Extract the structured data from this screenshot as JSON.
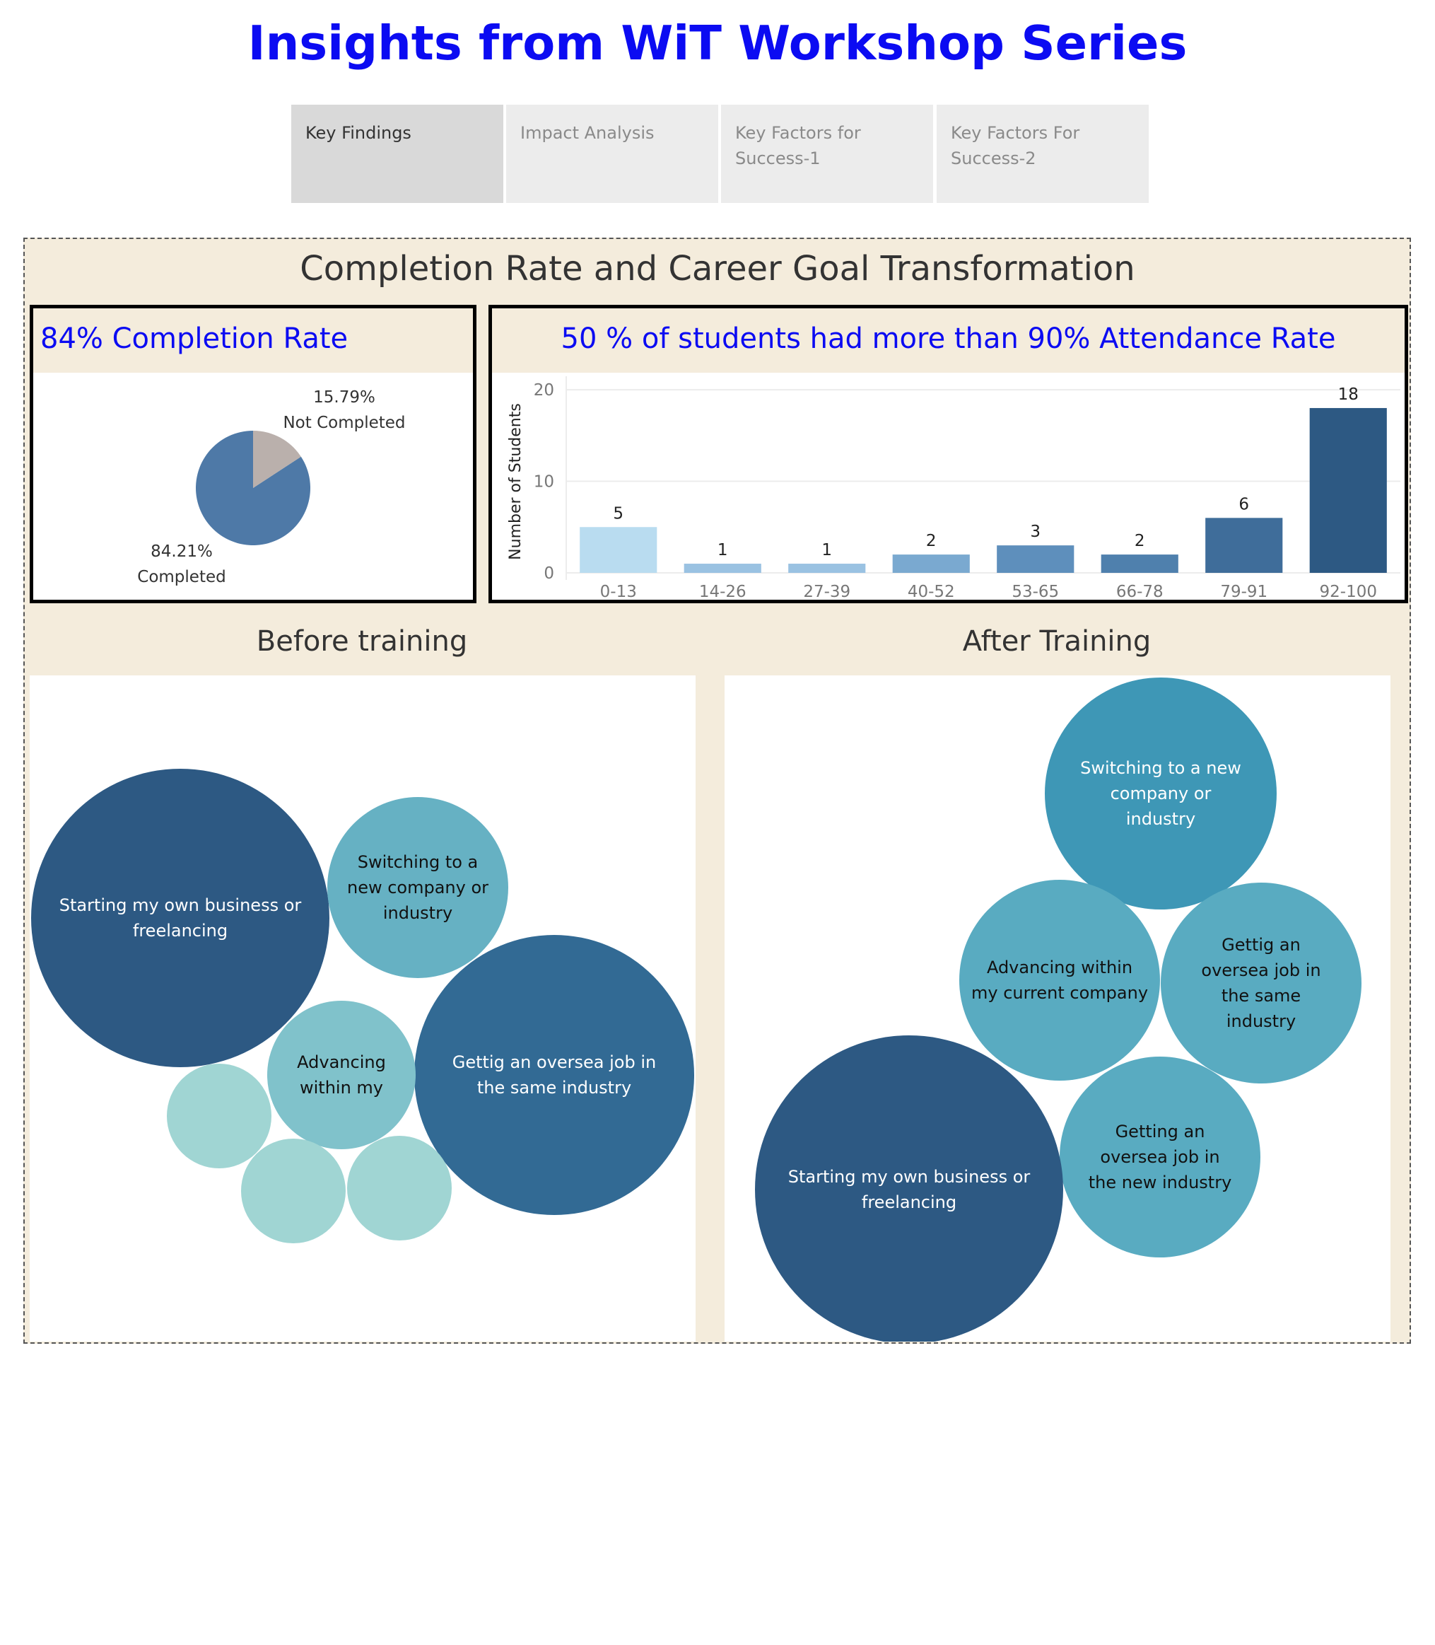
{
  "title": "Insights from WiT Workshop Series",
  "tabs": [
    {
      "label": "Key Findings",
      "active": true
    },
    {
      "label": "Impact Analysis",
      "active": false
    },
    {
      "label": "Key Factors for Success-1",
      "active": false
    },
    {
      "label": "Key Factors For Success-2",
      "active": false
    }
  ],
  "dashboard_title": "Completion Rate and Career Goal Transformation",
  "colors": {
    "title_blue": "#0b0bf2",
    "background": "#f4ecdc",
    "pie_completed": "#4e79a7",
    "pie_not_completed": "#bab0ac"
  },
  "chart_data": [
    {
      "type": "pie",
      "title": "84% Completion Rate",
      "slices": [
        {
          "label": "Completed",
          "value": 84.21,
          "display": "84.21%",
          "color": "#4e79a7"
        },
        {
          "label": "Not Completed",
          "value": 15.79,
          "display": "15.79%",
          "color": "#bab0ac"
        }
      ]
    },
    {
      "type": "bar",
      "title": "50 % of students had more than  90% Attendance Rate",
      "xlabel": "",
      "ylabel": "Number of Students",
      "categories": [
        "0-13",
        "14-26",
        "27-39",
        "40-52",
        "53-65",
        "66-78",
        "79-91",
        "92-100"
      ],
      "values": [
        5,
        1,
        1,
        2,
        3,
        2,
        6,
        18
      ],
      "colors": [
        "#b9dcf0",
        "#9ac2e2",
        "#9ac2e2",
        "#7aa9d0",
        "#5e8fbc",
        "#4f80ad",
        "#3f6d9a",
        "#2d5983"
      ],
      "yticks": [
        0,
        10,
        20
      ],
      "ylim": [
        0,
        20
      ],
      "grid": true
    },
    {
      "type": "bubble",
      "title": "Before training",
      "bubbles": [
        {
          "label": "Starting my own business or freelancing",
          "color": "#2d5983",
          "text_color": "#ffffff"
        },
        {
          "label": "Switching to a new company or industry",
          "color": "#66b1c3",
          "text_color": "#111111"
        },
        {
          "label": "Gettig an oversea job in the same industry",
          "color": "#326a94",
          "text_color": "#ffffff"
        },
        {
          "label": "Advancing within my",
          "color": "#80c2cb",
          "text_color": "#111111"
        },
        {
          "label": "",
          "color": "#a0d5d3",
          "text_color": "#111111"
        },
        {
          "label": "",
          "color": "#a0d5d3",
          "text_color": "#111111"
        },
        {
          "label": "",
          "color": "#a0d5d3",
          "text_color": "#111111"
        }
      ]
    },
    {
      "type": "bubble",
      "title": "After Training",
      "bubbles": [
        {
          "label": "Switching to a new company or industry",
          "color": "#3e97b6",
          "text_color": "#ffffff"
        },
        {
          "label": "Advancing within my current company",
          "color": "#59abc1",
          "text_color": "#111111"
        },
        {
          "label": "Gettig an oversea job in the same industry",
          "color": "#59abc1",
          "text_color": "#111111"
        },
        {
          "label": "Getting an oversea job in the new industry",
          "color": "#59abc1",
          "text_color": "#111111"
        },
        {
          "label": "Starting my own business or freelancing",
          "color": "#2d5983",
          "text_color": "#ffffff"
        }
      ]
    }
  ]
}
